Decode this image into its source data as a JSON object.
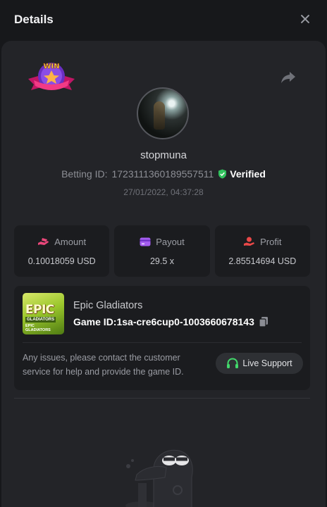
{
  "header": {
    "title": "Details"
  },
  "badge": {
    "text": "WIN"
  },
  "user": {
    "name": "stopmuna",
    "betting_id_label": "Betting ID:",
    "betting_id": "1723111360189557511",
    "verified_label": "Verified",
    "timestamp": "27/01/2022, 04:37:28"
  },
  "stats": [
    {
      "label": "Amount",
      "value": "0.10018059 USD",
      "icon": "money-hand-icon"
    },
    {
      "label": "Payout",
      "value": "29.5 x",
      "icon": "card-icon"
    },
    {
      "label": "Profit",
      "value": "2.85514694 USD",
      "icon": "coin-hand-icon"
    }
  ],
  "game": {
    "title": "Epic Gladiators",
    "id_label": "Game ID:",
    "id": "1sa-cre6cup0-1003660678143",
    "thumb_title": "EPIC",
    "thumb_subtitle": "GLADIATORS",
    "thumb_footer": "EPIC GLADIATORS"
  },
  "support": {
    "message": "Any issues, please contact the customer service for help and provide the game ID.",
    "button_label": "Live Support"
  },
  "colors": {
    "accent_pink": "#e9477a",
    "accent_purple": "#a45cf0",
    "accent_red": "#ea4848",
    "verified_green": "#31c15d",
    "support_green": "#42d96b"
  }
}
